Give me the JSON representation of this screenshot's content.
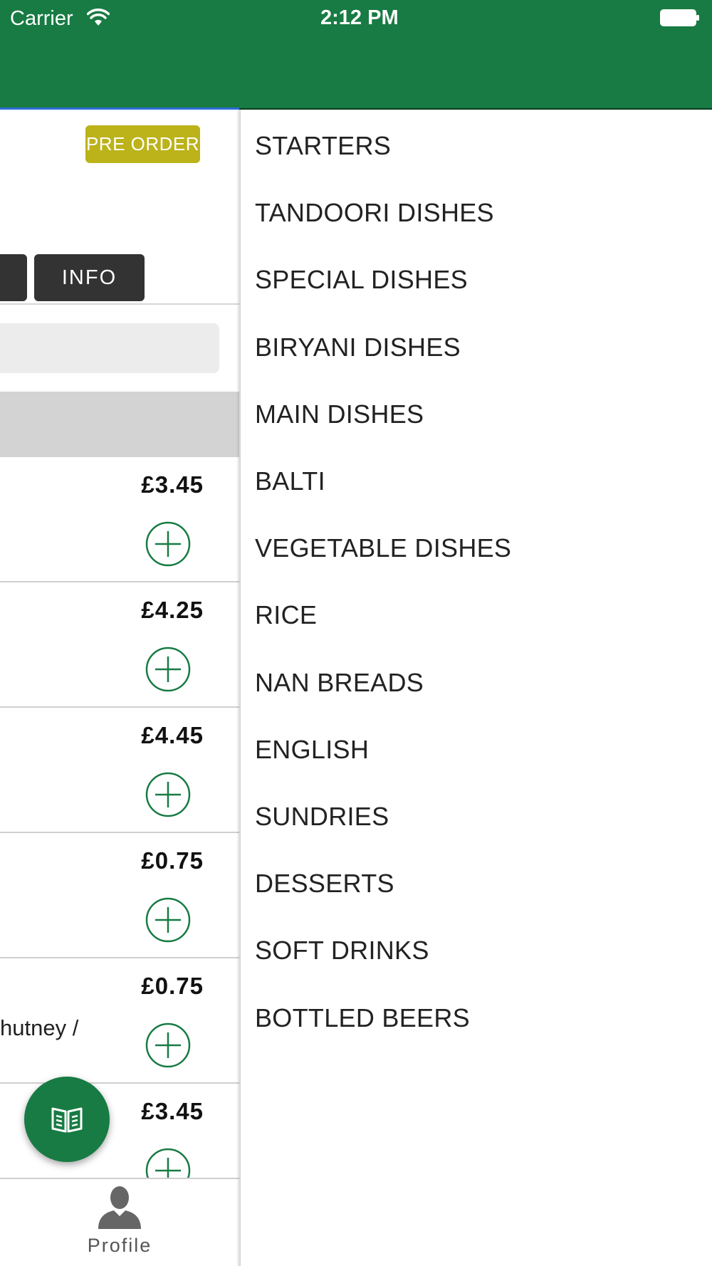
{
  "status_bar": {
    "carrier": "Carrier",
    "time": "2:12 PM"
  },
  "left_panel": {
    "preorder_label": "PRE ORDER",
    "tabs": [
      {
        "label": ""
      },
      {
        "label": "INFO"
      }
    ],
    "items": [
      {
        "price": "£3.45",
        "desc": ""
      },
      {
        "price": "£4.25",
        "desc": ""
      },
      {
        "price": "£4.45",
        "desc": ""
      },
      {
        "price": "£0.75",
        "desc": ""
      },
      {
        "price": "£0.75",
        "desc": "hutney /"
      },
      {
        "price": "£3.45",
        "desc": ""
      }
    ],
    "bottom_nav": {
      "profile_label": "Profile"
    }
  },
  "drawer": {
    "categories": [
      "STARTERS",
      "TANDOORI DISHES",
      "SPECIAL DISHES",
      "BIRYANI DISHES",
      "MAIN DISHES",
      "BALTI",
      "VEGETABLE DISHES",
      "RICE",
      "NAN BREADS",
      "ENGLISH",
      "SUNDRIES",
      "DESSERTS",
      "SOFT DRINKS",
      "BOTTLED BEERS"
    ]
  },
  "colors": {
    "brand_green": "#177b43",
    "preorder_yellow": "#bcb21a",
    "tab_dark": "#333333"
  },
  "icons": {
    "wifi": "wifi-icon",
    "battery": "battery-icon",
    "add": "plus-circle-icon",
    "menu_fab": "book-icon",
    "profile": "person-icon"
  }
}
